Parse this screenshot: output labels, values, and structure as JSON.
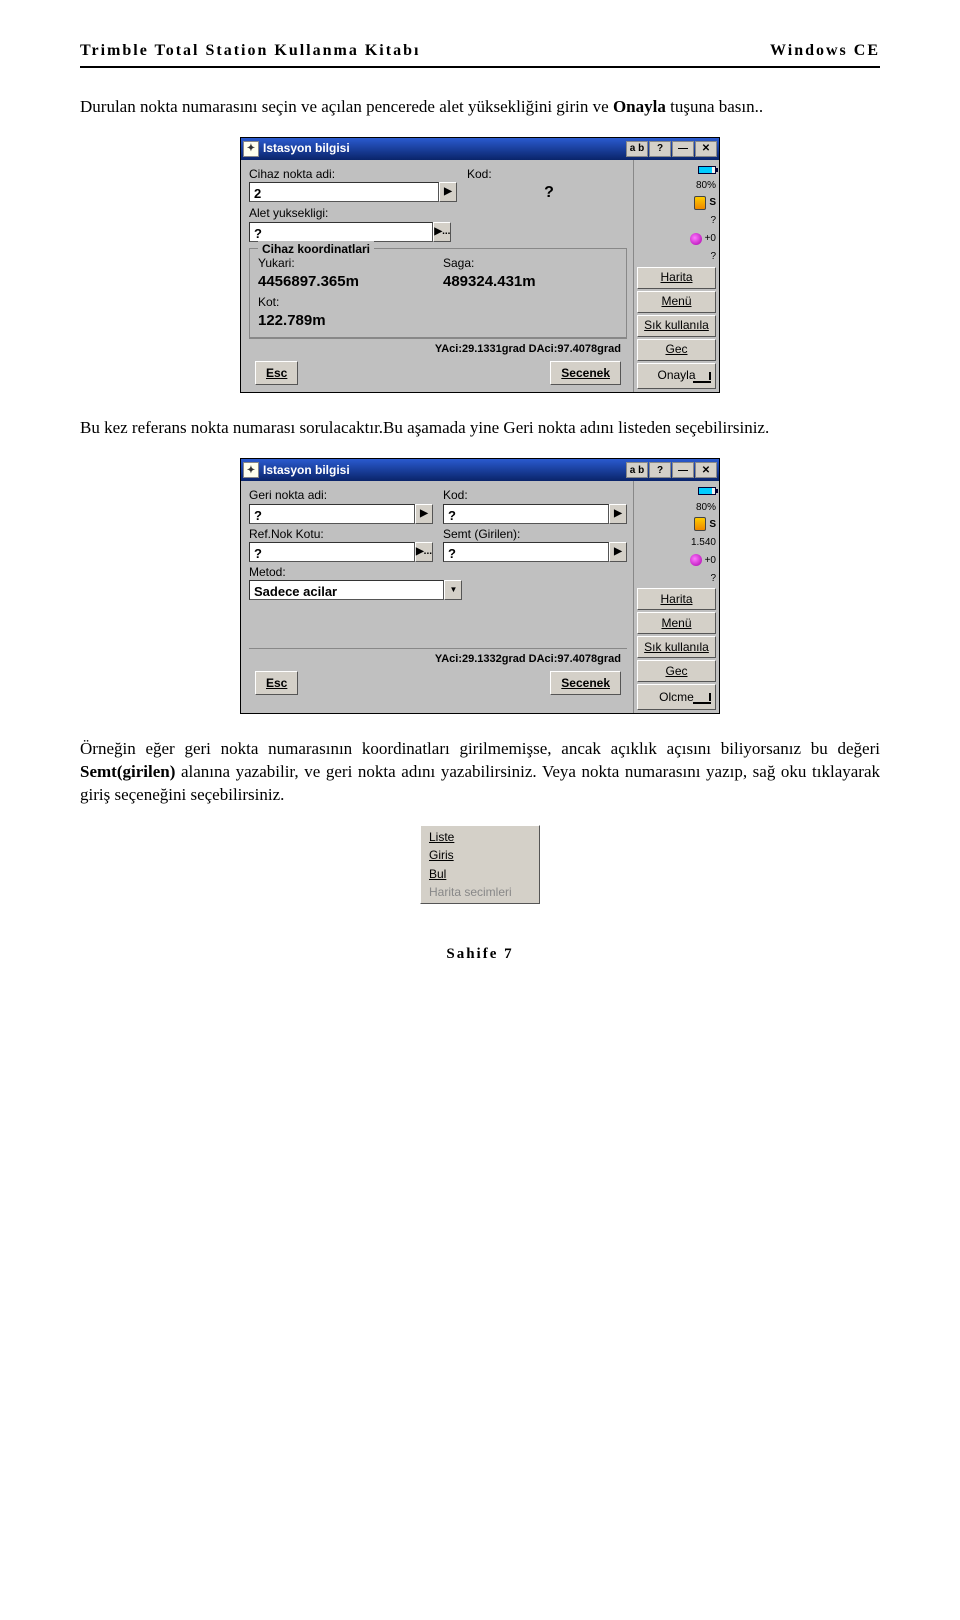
{
  "header": {
    "left": "Trimble Total Station Kullanma Kitabı",
    "right": "Windows CE"
  },
  "para1_a": "Durulan nokta numarasını seçin ve açılan pencerede alet yüksekliğini girin ve ",
  "para1_b": "Onayla",
  "para1_c": " tuşuna basın..",
  "para2": "Bu kez referans nokta numarası sorulacaktır.Bu aşamada yine Geri nokta adını listeden seçebilirsiniz.",
  "para3_a": "Örneğin eğer geri nokta numarasının koordinatları girilmemişse, ancak açıklık açısını biliyorsanız bu değeri ",
  "para3_b": "Semt(girilen)",
  "para3_c": " alanına yazabilir, ve geri nokta adını yazabilirsiniz. Veya nokta numarasını yazıp, sağ oku tıklayarak giriş seçeneğini seçebilirsiniz.",
  "win1": {
    "title": "Istasyon bilgisi",
    "ab": "a b",
    "labels": {
      "cihaz": "Cihaz nokta adi:",
      "kod": "Kod:",
      "alet": "Alet yuksekligi:",
      "group": "Cihaz koordinatlari",
      "yukari": "Yukari:",
      "saga": "Saga:",
      "kot": "Kot:"
    },
    "vals": {
      "cihaz": "2",
      "alet": "?",
      "yukari": "4456897.365m",
      "saga": "489324.431m",
      "kot": "122.789m"
    },
    "status": "YAci:29.1331grad  DAci:97.4078grad",
    "side": {
      "bat": "80%",
      "s": "S",
      "q": "?",
      "plus": "+0",
      "q2": "?",
      "btns": [
        "Harita",
        "Menü",
        "Sık kullanıla",
        "Gec"
      ],
      "confirm": "Onayla"
    },
    "esc": "Esc",
    "sec": "Secenek"
  },
  "win2": {
    "title": "Istasyon bilgisi",
    "ab": "a b",
    "labels": {
      "geri": "Geri nokta adi:",
      "kod": "Kod:",
      "ref": "Ref.Nok Kotu:",
      "semt": "Semt (Girilen):",
      "metod": "Metod:"
    },
    "vals": {
      "geri": "?",
      "kod": "?",
      "ref": "?",
      "semt": "?",
      "metod": "Sadece acilar"
    },
    "status": "YAci:29.1332grad  DAci:97.4078grad",
    "side": {
      "bat": "80%",
      "s": "S",
      "h": "1.540",
      "plus": "+0",
      "q2": "?",
      "btns": [
        "Harita",
        "Menü",
        "Sık kullanıla",
        "Gec"
      ],
      "confirm": "Olcme"
    },
    "esc": "Esc",
    "sec": "Secenek"
  },
  "popup": {
    "items": [
      "Liste",
      "Giris",
      "Bul"
    ],
    "disabled": "Harita secimleri"
  },
  "footer": "Sahife 7"
}
